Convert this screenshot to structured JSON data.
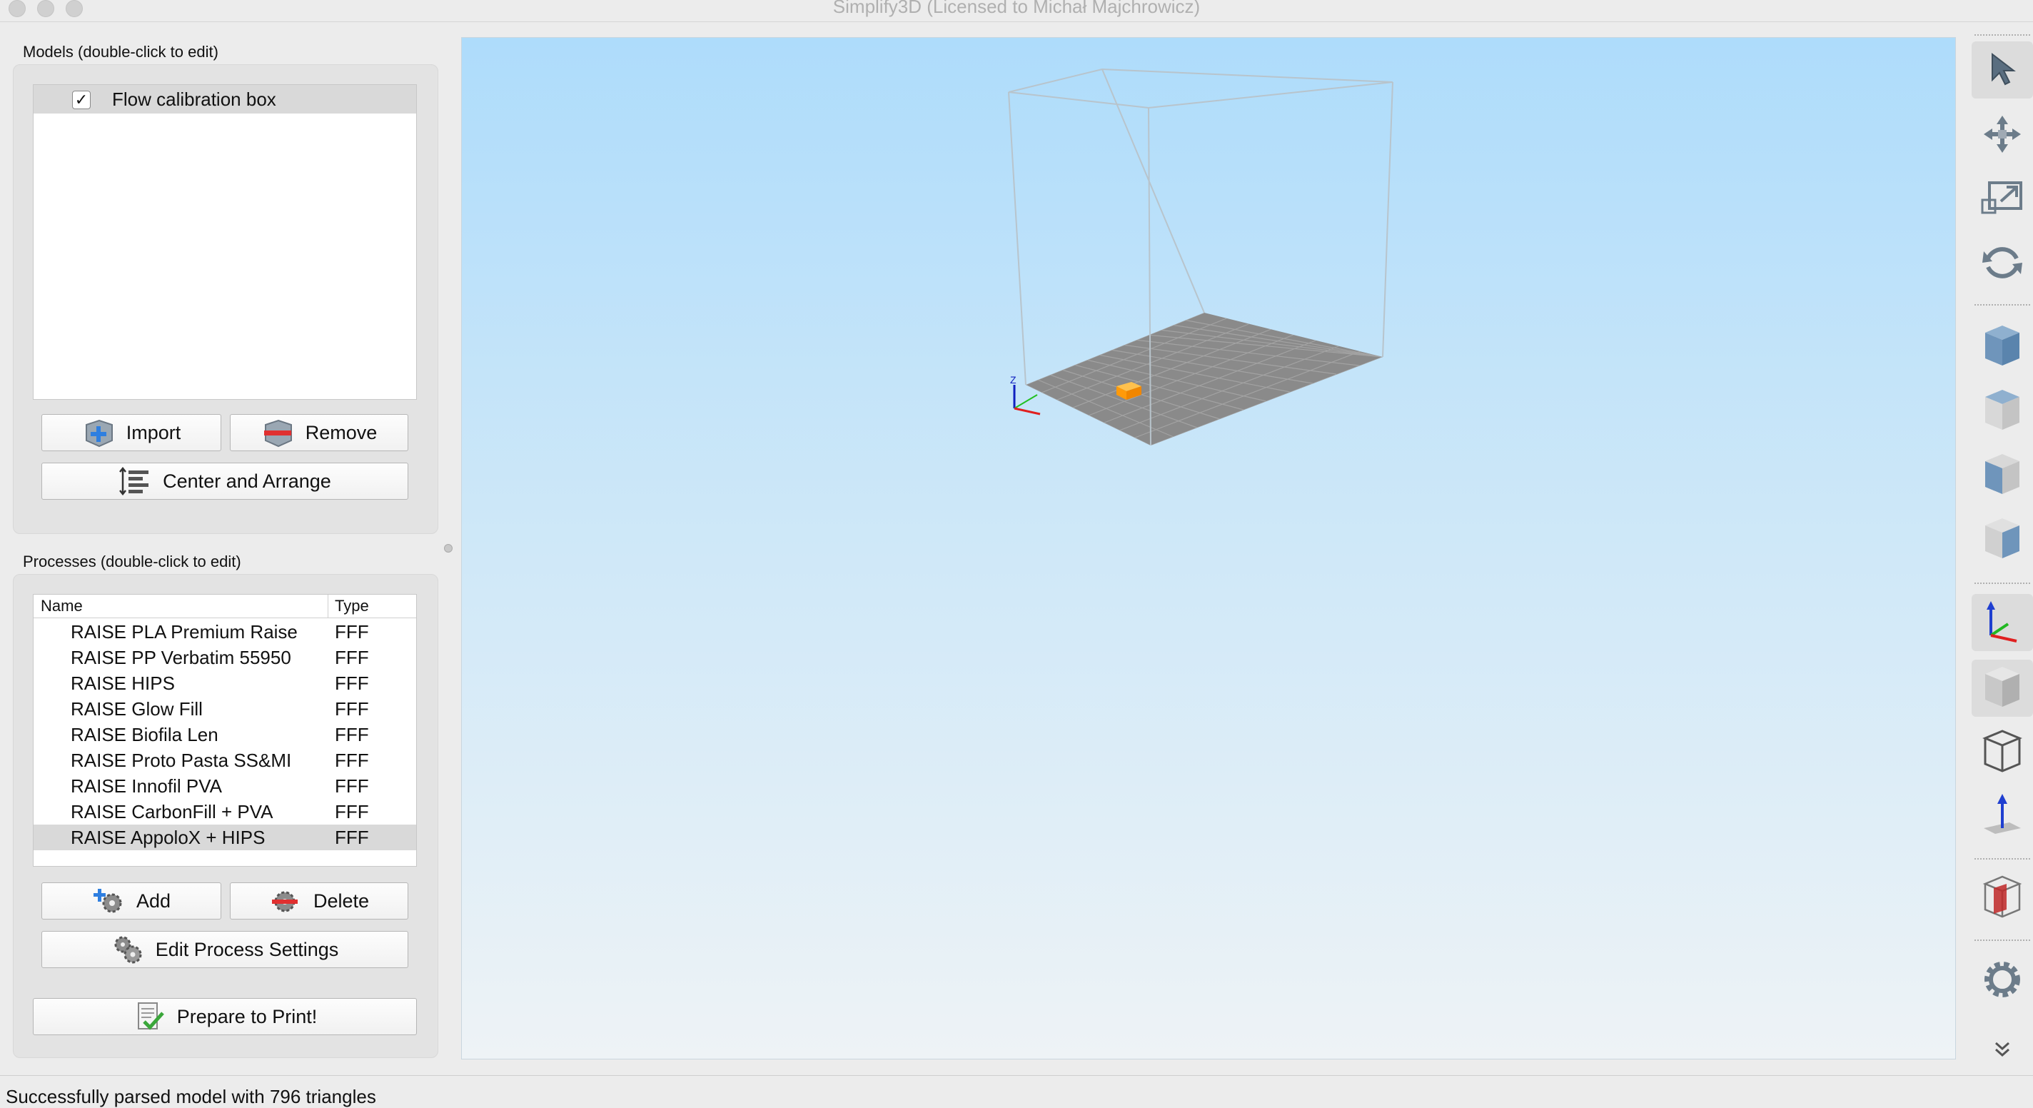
{
  "window": {
    "title": "Simplify3D (Licensed to Michał Majchrowicz)"
  },
  "models": {
    "title": "Models (double-click to edit)",
    "items": [
      {
        "label": "Flow calibration box",
        "checked": true
      }
    ],
    "import_label": "Import",
    "remove_label": "Remove",
    "center_label": "Center and Arrange"
  },
  "processes": {
    "title": "Processes (double-click to edit)",
    "columns": [
      "Name",
      "Type"
    ],
    "rows": [
      {
        "name": "RAISE PLA Premium Raise",
        "type": "FFF"
      },
      {
        "name": "RAISE PP Verbatim 55950",
        "type": "FFF"
      },
      {
        "name": "RAISE HIPS",
        "type": "FFF"
      },
      {
        "name": "RAISE Glow Fill",
        "type": "FFF"
      },
      {
        "name": "RAISE Biofila Len",
        "type": "FFF"
      },
      {
        "name": "RAISE Proto Pasta SS&MI",
        "type": "FFF"
      },
      {
        "name": "RAISE Innofil PVA",
        "type": "FFF"
      },
      {
        "name": "RAISE CarbonFill + PVA",
        "type": "FFF"
      },
      {
        "name": "RAISE AppoloX + HIPS",
        "type": "FFF"
      }
    ],
    "selected_row": "RAISE AppoloX + HIPS",
    "add_label": "Add",
    "delete_label": "Delete",
    "edit_label": "Edit Process Settings",
    "prepare_label": "Prepare to Print!"
  },
  "viewport": {
    "axis_label_z": "Z",
    "model_color": "#ffa31a",
    "bed_color": "#8a8a8a"
  },
  "toolbar": {
    "tools": [
      "select-icon",
      "move-icon",
      "scale-icon",
      "rotate-icon",
      "view-iso-icon",
      "view-front-icon",
      "view-top-icon",
      "view-side-icon",
      "axes-icon",
      "solid-view-icon",
      "wireframe-view-icon",
      "build-direction-icon",
      "cross-section-icon",
      "settings-gear-icon",
      "expand-more-icon"
    ]
  },
  "status": {
    "text": "Successfully parsed model with 796 triangles"
  }
}
